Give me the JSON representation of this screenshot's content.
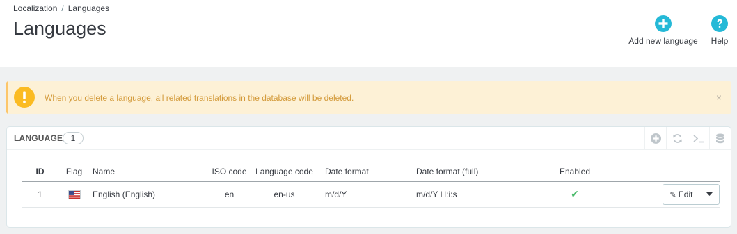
{
  "breadcrumb": {
    "parent": "Localization",
    "separator": "/",
    "current": "Languages"
  },
  "page": {
    "title": "Languages"
  },
  "toolbar": {
    "add_label": "Add new language",
    "help_label": "Help"
  },
  "alert": {
    "text": "When you delete a language, all related translations in the database will be deleted.",
    "close": "×"
  },
  "panel": {
    "title": "LANGUAGES",
    "count": "1"
  },
  "table": {
    "headers": {
      "id": "ID",
      "flag": "Flag",
      "name": "Name",
      "iso": "ISO code",
      "lang_code": "Language code",
      "date_format": "Date format",
      "date_format_full": "Date format (full)",
      "enabled": "Enabled"
    },
    "rows": [
      {
        "id": "1",
        "name": "English (English)",
        "iso": "en",
        "lang_code": "en-us",
        "date_format": "m/d/Y",
        "date_format_full": "m/d/Y H:i:s",
        "enabled": "✔",
        "action": "Edit"
      }
    ]
  },
  "colors": {
    "accent": "#25b9d7",
    "warning_bg": "#fdf1d6",
    "warning_border": "#fcc66b",
    "success": "#4cbb6c"
  },
  "icons": {
    "add": "plus-circle-icon",
    "help": "question-circle-icon",
    "alert": "exclamation-circle-icon"
  }
}
